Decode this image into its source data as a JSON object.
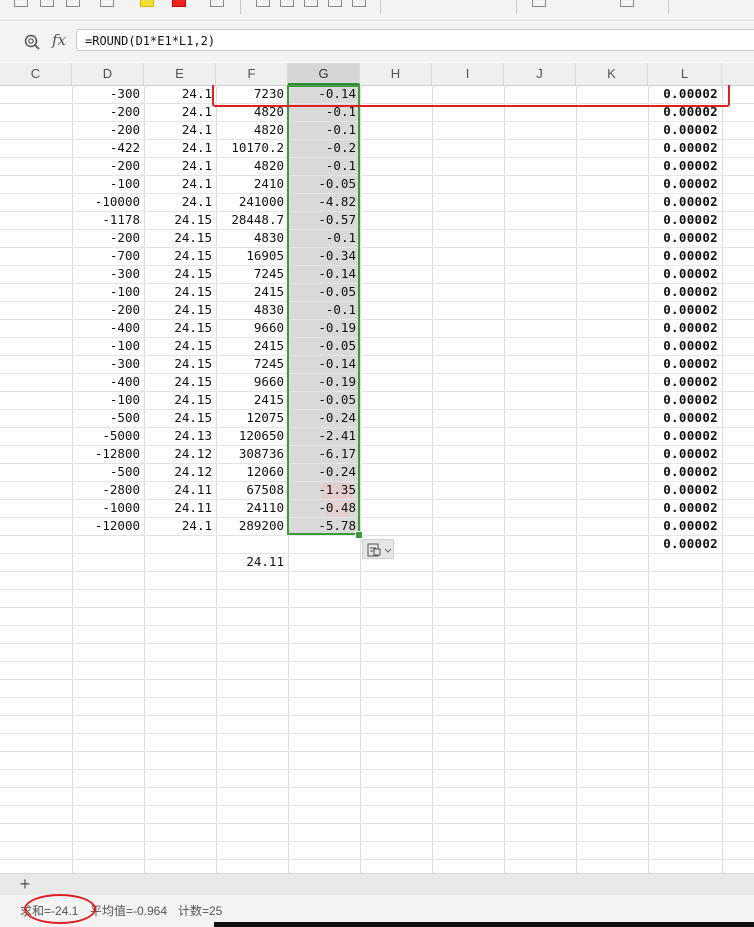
{
  "formula_bar": {
    "formula": "=ROUND(D1*E1*L1,2)",
    "fx_label": "fx",
    "zoom_icon": "magnifier-zoom-icon"
  },
  "columns": [
    "C",
    "D",
    "E",
    "F",
    "G",
    "H",
    "I",
    "J",
    "K",
    "L"
  ],
  "selected_column": "G",
  "rows": [
    {
      "D": "-300",
      "E": "24.1",
      "F": "7230",
      "G": "-0.14",
      "L": "0.00002"
    },
    {
      "D": "-200",
      "E": "24.1",
      "F": "4820",
      "G": "-0.1",
      "L": "0.00002"
    },
    {
      "D": "-200",
      "E": "24.1",
      "F": "4820",
      "G": "-0.1",
      "L": "0.00002"
    },
    {
      "D": "-422",
      "E": "24.1",
      "F": "10170.2",
      "G": "-0.2",
      "L": "0.00002"
    },
    {
      "D": "-200",
      "E": "24.1",
      "F": "4820",
      "G": "-0.1",
      "L": "0.00002"
    },
    {
      "D": "-100",
      "E": "24.1",
      "F": "2410",
      "G": "-0.05",
      "L": "0.00002"
    },
    {
      "D": "-10000",
      "E": "24.1",
      "F": "241000",
      "G": "-4.82",
      "L": "0.00002"
    },
    {
      "D": "-1178",
      "E": "24.15",
      "F": "28448.7",
      "G": "-0.57",
      "L": "0.00002"
    },
    {
      "D": "-200",
      "E": "24.15",
      "F": "4830",
      "G": "-0.1",
      "L": "0.00002"
    },
    {
      "D": "-700",
      "E": "24.15",
      "F": "16905",
      "G": "-0.34",
      "L": "0.00002"
    },
    {
      "D": "-300",
      "E": "24.15",
      "F": "7245",
      "G": "-0.14",
      "L": "0.00002"
    },
    {
      "D": "-100",
      "E": "24.15",
      "F": "2415",
      "G": "-0.05",
      "L": "0.00002"
    },
    {
      "D": "-200",
      "E": "24.15",
      "F": "4830",
      "G": "-0.1",
      "L": "0.00002"
    },
    {
      "D": "-400",
      "E": "24.15",
      "F": "9660",
      "G": "-0.19",
      "L": "0.00002"
    },
    {
      "D": "-100",
      "E": "24.15",
      "F": "2415",
      "G": "-0.05",
      "L": "0.00002"
    },
    {
      "D": "-300",
      "E": "24.15",
      "F": "7245",
      "G": "-0.14",
      "L": "0.00002"
    },
    {
      "D": "-400",
      "E": "24.15",
      "F": "9660",
      "G": "-0.19",
      "L": "0.00002"
    },
    {
      "D": "-100",
      "E": "24.15",
      "F": "2415",
      "G": "-0.05",
      "L": "0.00002"
    },
    {
      "D": "-500",
      "E": "24.15",
      "F": "12075",
      "G": "-0.24",
      "L": "0.00002"
    },
    {
      "D": "-5000",
      "E": "24.13",
      "F": "120650",
      "G": "-2.41",
      "L": "0.00002"
    },
    {
      "D": "-12800",
      "E": "24.12",
      "F": "308736",
      "G": "-6.17",
      "L": "0.00002"
    },
    {
      "D": "-500",
      "E": "24.12",
      "F": "12060",
      "G": "-0.24",
      "L": "0.00002"
    },
    {
      "D": "-2800",
      "E": "24.11",
      "F": "67508",
      "G": "-1.35",
      "L": "0.00002"
    },
    {
      "D": "-1000",
      "E": "24.11",
      "F": "24110",
      "G": "-0.48",
      "L": "0.00002"
    },
    {
      "D": "-12000",
      "E": "24.1",
      "F": "289200",
      "G": "-5.78",
      "L": "0.00002"
    },
    {
      "D": "",
      "E": "",
      "F": "",
      "G": "",
      "L": "0.00002"
    },
    {
      "D": "",
      "E": "",
      "F": "24.11",
      "G": "",
      "L": ""
    }
  ],
  "sheet_bar": {
    "add_sheet_icon": "plus-icon"
  },
  "status_bar": {
    "sum": "求和=-24.1",
    "average": "平均值=-0.964",
    "count": "计数=25"
  },
  "colors": {
    "selection_border": "#3c9a3c",
    "annotation_red": "#e02020",
    "selection_fill": "#d9d9d9"
  }
}
